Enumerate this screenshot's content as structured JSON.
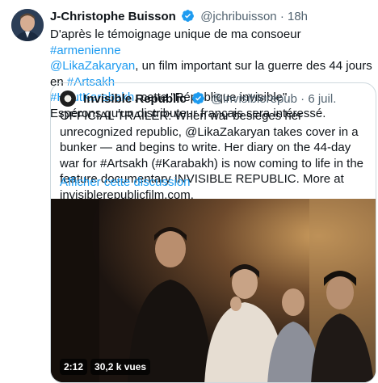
{
  "tweet": {
    "author_name": "J-Christophe Buisson",
    "author_handle": "@jchribuisson",
    "separator": "·",
    "time": "18h",
    "line1_pre": "D'après le témoignage unique de ma consoeur ",
    "line1_tag": "#armenienne",
    "mention": "@LikaZakaryan",
    "line2_mid": ", un film important sur la guerre des 44 jours en ",
    "tag_artsakh": "#Artsakh",
    "tag_haut": "#HautKarabakh",
    "line3_post": ", cette \"République invisible\".",
    "line4": "Espérons qu'un distributeur français sera intéressé."
  },
  "quote": {
    "author_name": "Invisible Republic",
    "author_handle": "@invisiblerepub",
    "separator": "·",
    "date": "6 juil.",
    "text": "OFFICIAL TRAILER: When war besieges her unrecognized republic, @LikaZakaryan takes cover in a bunker — and begins to write. Her diary on the 44-day war for #Artsakh (#Karabakh) is now coming to life in the feature documentary INVISIBLE REPUBLIC. More at invisiblerepublicfilm.com.",
    "show_thread": "Afficher cette discussion"
  },
  "video": {
    "duration": "2:12",
    "views": "30,2 k vues"
  },
  "colors": {
    "link": "#1d9bf0",
    "verified": "#1d9bf0",
    "muted": "#536471"
  }
}
